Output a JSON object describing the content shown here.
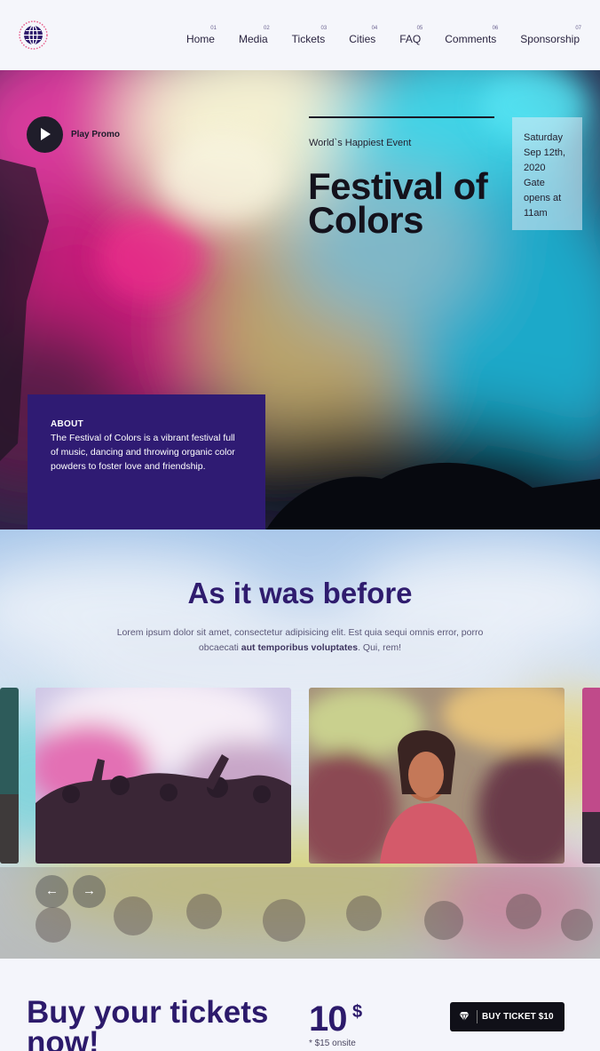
{
  "header": {
    "logo": "globe-icon",
    "nav": [
      {
        "num": "01",
        "label": "Home"
      },
      {
        "num": "02",
        "label": "Media"
      },
      {
        "num": "03",
        "label": "Tickets"
      },
      {
        "num": "04",
        "label": "Cities"
      },
      {
        "num": "05",
        "label": "FAQ"
      },
      {
        "num": "06",
        "label": "Comments"
      },
      {
        "num": "07",
        "label": "Sponsorship"
      }
    ]
  },
  "hero": {
    "play_label": "Play Promo",
    "kicker": "World`s Happiest Event",
    "title": "Festival of Colors",
    "date_lines": [
      "Saturday",
      "Sep 12th,",
      "2020",
      "Gate",
      "opens at",
      "11am"
    ],
    "about": {
      "title": "ABOUT",
      "text": "The Festival of Colors is a vibrant festival full of music, dancing and throwing organic color powders to foster love and friendship."
    }
  },
  "gallery": {
    "title": "As it was before",
    "subtitle_plain": "Lorem ipsum dolor sit amet, consectetur adipisicing elit. Est quia sequi omnis error, porro obcaecati",
    "subtitle_bold": "aut temporibus voluptates",
    "subtitle_end": ". Qui, rem!",
    "prev_icon": "←",
    "next_icon": "→"
  },
  "tickets": {
    "title": "Buy your tickets now!",
    "price": "10",
    "currency": "$",
    "note": "* $15 onsite",
    "button_label": "BUY TICKET $10",
    "button_icon": "diamond-icon"
  },
  "colors": {
    "brand_purple": "#2f1b73",
    "dark": "#101018",
    "page_bg": "#f4f5fb"
  }
}
